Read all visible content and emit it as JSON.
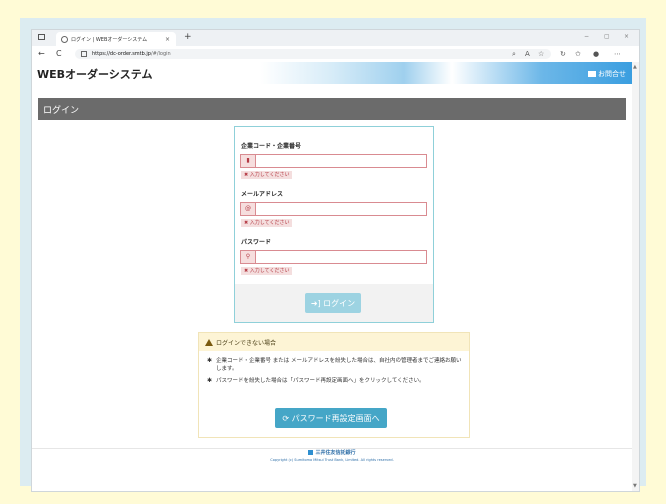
{
  "browser": {
    "tab_title": "ログイン | WEBオーダーシステム",
    "tab_close": "×",
    "new_tab": "+",
    "nav_back": "←",
    "nav_reload": "C",
    "url_host": "https://dc-order.smtb.jp",
    "url_path": "/#/login",
    "window_minimize": "−",
    "window_restore": "▢",
    "window_close": "×"
  },
  "header": {
    "title": "WEBオーダーシステム",
    "contact_label": "お問合せ"
  },
  "section": {
    "title": "ログイン"
  },
  "form": {
    "company_label": "企業コード・企業番号",
    "company_icon": "▮",
    "company_error": "✖ 入力してください",
    "email_label": "メールアドレス",
    "email_icon": "@",
    "email_error": "✖ 入力してください",
    "password_label": "パスワード",
    "password_icon": "⚲",
    "password_error": "✖ 入力してください",
    "login_button": "➜] ログイン"
  },
  "help": {
    "title": "ログインできない場合",
    "item1": "企業コード・企業番号 または メールアドレスを紛失した場合は、自社内の管理者までご連絡お願いします。",
    "item2": "パスワードを紛失した場合は「パスワード再設定画面へ」をクリックしてください。",
    "bullet": "✱",
    "reset_button": "⟳ パスワード再設定画面へ"
  },
  "footer": {
    "logo_text": "三井住友信託銀行",
    "copyright": "Copyright (c) Sumitomo Mitsui Trust Bank, Limited. All rights reserved."
  },
  "colors": {
    "background": "#fffbd6",
    "section_bar": "#6b6b6b",
    "error_red": "#b43a44",
    "accent_blue": "#45a6c7"
  }
}
